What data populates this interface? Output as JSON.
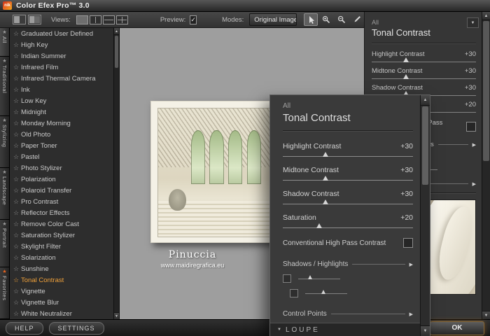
{
  "titlebar": {
    "logo_text": "nik",
    "title": "Color Efex Pro™ 3.0"
  },
  "toolbar": {
    "views_label": "Views:",
    "preview_label": "Preview:",
    "preview_checked": true,
    "modes_label": "Modes:",
    "modes_value": "Original Image"
  },
  "tabs": [
    {
      "label": "All",
      "star_color": "#9a9a9a",
      "active": true
    },
    {
      "label": "Traditional",
      "star_color": "#9a9a9a",
      "active": false
    },
    {
      "label": "Stylizing",
      "star_color": "#9a9a9a",
      "active": false
    },
    {
      "label": "Landscape",
      "star_color": "#9a9a9a",
      "active": false
    },
    {
      "label": "Portrait",
      "star_color": "#9a9a9a",
      "active": false
    },
    {
      "label": "Favorites",
      "star_color": "#e8641f",
      "active": false
    }
  ],
  "filter_list": {
    "items": [
      "Graduated User Defined",
      "High Key",
      "Indian Summer",
      "Infrared Film",
      "Infrared Thermal Camera",
      "Ink",
      "Low Key",
      "Midnight",
      "Monday Morning",
      "Old Photo",
      "Paper Toner",
      "Pastel",
      "Photo Stylizer",
      "Polarization",
      "Polaroid Transfer",
      "Pro Contrast",
      "Reflector Effects",
      "Remove Color Cast",
      "Saturation Stylizer",
      "Skylight Filter",
      "Solarization",
      "Sunshine",
      "Tonal Contrast",
      "Vignette",
      "Vignette Blur",
      "White Neutralizer"
    ],
    "selected": "Tonal Contrast",
    "selected_color": "#f0a13a"
  },
  "canvas": {
    "caption_title": "Pinuccia",
    "caption_url": "www.maidiregrafica.eu"
  },
  "panel": {
    "category_label": "All",
    "title": "Tonal Contrast",
    "sliders": [
      {
        "label": "Highlight Contrast",
        "value": "+30",
        "percent": 33
      },
      {
        "label": "Midtone Contrast",
        "value": "+30",
        "percent": 33
      },
      {
        "label": "Shadow Contrast",
        "value": "+30",
        "percent": 33
      },
      {
        "label": "Saturation",
        "value": "+20",
        "percent": 28
      }
    ],
    "checkbox_label": "Conventional High Pass Contrast",
    "checkbox_checked": false,
    "sections": [
      {
        "label": "Shadows / Highlights"
      },
      {
        "label": "Control Points"
      }
    ],
    "loupe_label": "LOUPE"
  },
  "footer": {
    "help_label": "HELP",
    "settings_label": "SETTINGS",
    "ok_label": "OK"
  },
  "colors": {
    "accent_orange": "#f0a13a",
    "favorites_star": "#e8641f"
  }
}
